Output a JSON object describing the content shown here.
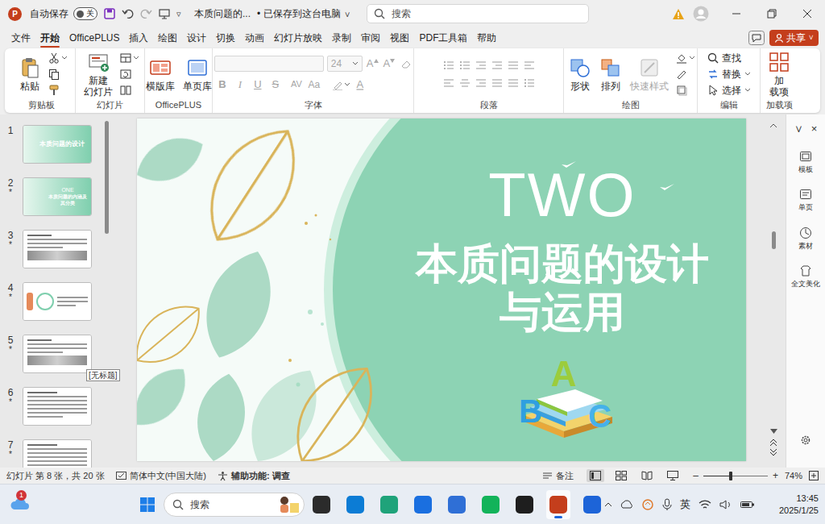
{
  "app": {
    "logo": "P"
  },
  "titlebar": {
    "autosave_label": "自动保存",
    "autosave": {
      "on": false,
      "state": "关"
    },
    "doc_title": "本质问题的...",
    "save_status": "• 已保存到这台电脑",
    "save_caret": "∨",
    "customize": "▿"
  },
  "search": {
    "placeholder": "搜索"
  },
  "menu": {
    "tabs": [
      {
        "label": "文件",
        "selected": false
      },
      {
        "label": "开始",
        "selected": true
      },
      {
        "label": "OfficePLUS",
        "selected": false
      },
      {
        "label": "插入",
        "selected": false
      },
      {
        "label": "绘图",
        "selected": false
      },
      {
        "label": "设计",
        "selected": false
      },
      {
        "label": "切换",
        "selected": false
      },
      {
        "label": "动画",
        "selected": false
      },
      {
        "label": "幻灯片放映",
        "selected": false
      },
      {
        "label": "录制",
        "selected": false
      },
      {
        "label": "审阅",
        "selected": false
      },
      {
        "label": "视图",
        "selected": false
      },
      {
        "label": "PDF工具箱",
        "selected": false
      },
      {
        "label": "帮助",
        "selected": false
      }
    ],
    "share": "共享",
    "share_caret": "∨"
  },
  "ribbon": {
    "groups": [
      {
        "label": "剪贴板",
        "buttons": [
          {
            "lines": [
              "粘贴"
            ],
            "kind": "large",
            "disabled": false
          }
        ]
      },
      {
        "label": "幻灯片",
        "buttons": [
          {
            "lines": [
              "新建",
              "幻灯片"
            ],
            "kind": "large",
            "disabled": false
          }
        ]
      },
      {
        "label": "OfficePLUS",
        "buttons": [
          {
            "lines": [
              "横版库"
            ],
            "kind": "large",
            "disabled": false
          },
          {
            "lines": [
              "单页库"
            ],
            "kind": "large",
            "disabled": false
          }
        ]
      },
      {
        "label": "字体",
        "font_size": "24",
        "size_buttons": [
          "A",
          "A"
        ],
        "format_buttons": [
          "B",
          "I",
          "U",
          "S",
          "AV",
          "Aa",
          "A"
        ],
        "disabled": true,
        "buttons": []
      },
      {
        "label": "段落",
        "buttons": []
      },
      {
        "label": "绘图",
        "buttons": [
          {
            "lines": [
              "形状"
            ],
            "kind": "large",
            "disabled": false
          },
          {
            "lines": [
              "排列"
            ],
            "kind": "large",
            "disabled": false
          },
          {
            "lines": [
              "快速样式"
            ],
            "kind": "large",
            "disabled": true
          }
        ]
      },
      {
        "label": "编辑",
        "buttons": [
          {
            "lines": [
              "查找"
            ],
            "kind": "small",
            "disabled": false
          },
          {
            "lines": [
              "替换"
            ],
            "kind": "small",
            "disabled": false
          },
          {
            "lines": [
              "选择"
            ],
            "kind": "small",
            "disabled": false
          }
        ]
      },
      {
        "label": "加载项",
        "buttons": [
          {
            "lines": [
              "加",
              "载项"
            ],
            "kind": "large",
            "disabled": false
          }
        ]
      }
    ]
  },
  "thumbnails": [
    {
      "number": "1",
      "kind": "title",
      "texts": [
        "本质问题的设计"
      ],
      "selected": false
    },
    {
      "number": "2",
      "star": "*",
      "kind": "section",
      "texts": [
        "ONE",
        "本质问题的内涵及其分类"
      ],
      "selected": false
    },
    {
      "number": "3",
      "star": "*",
      "kind": "text-photo",
      "texts": [],
      "selected": false
    },
    {
      "number": "4",
      "star": "*",
      "kind": "image-text",
      "texts": [],
      "selected": false
    },
    {
      "number": "5",
      "star": "*",
      "kind": "text-photo",
      "texts": [],
      "selected": false
    },
    {
      "number": "6",
      "star": "*",
      "kind": "text",
      "texts": [],
      "selected": false
    },
    {
      "number": "7",
      "star": "*",
      "kind": "text",
      "texts": [],
      "selected": false
    }
  ],
  "tooltip": "[无标题]",
  "slide": {
    "label": "TWO",
    "title_lines": [
      "本质问题的设计",
      "与运用"
    ],
    "letters": [
      "A",
      "B",
      "C"
    ]
  },
  "right_pane": {
    "controls": [
      "∨",
      "×"
    ],
    "items": [
      {
        "label": "模板"
      },
      {
        "label": "单页"
      },
      {
        "label": "素材"
      },
      {
        "label": "全文美化"
      }
    ]
  },
  "status": {
    "slide_info": "幻灯片 第 8 张，共 20 张",
    "language": "简体中文(中国大陆)",
    "accessibility": "辅助功能: 调查",
    "notes": "备注",
    "views": [
      {
        "selected": true
      },
      {
        "selected": false
      },
      {
        "selected": false
      },
      {
        "selected": false
      }
    ],
    "zoom_minus": "–",
    "zoom_plus": "+",
    "zoom_level": 0.42,
    "zoom": "74%"
  },
  "taskbar": {
    "notification_badge": "1",
    "search_placeholder": "搜索",
    "apps": [
      {
        "color": "#2b2b2b",
        "selected": false
      },
      {
        "color": "#0c7cd5",
        "selected": false
      },
      {
        "color": "#1fa37a",
        "selected": false
      },
      {
        "color": "#1a6fe0",
        "selected": false
      },
      {
        "color": "#2f6fd6",
        "selected": false
      },
      {
        "color": "#12b35a",
        "selected": false
      },
      {
        "color": "#1e1e1e",
        "selected": false
      },
      {
        "color": "#c43e1c",
        "selected": true
      },
      {
        "color": "#1d64d8",
        "selected": false
      }
    ],
    "ime": "英",
    "time": "13:45",
    "date": "2025/1/25"
  }
}
